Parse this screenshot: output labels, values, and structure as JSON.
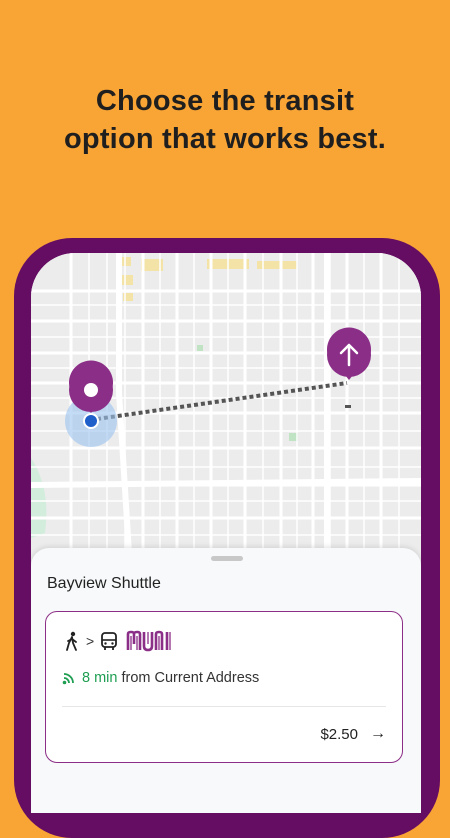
{
  "headline": {
    "line1": "Choose the transit",
    "line2": "option that works best."
  },
  "map": {
    "origin_pin_icon": "location-pin-icon",
    "destination_pin_icon": "up-arrow-pin-icon",
    "accent_color": "#8B2E87"
  },
  "sheet": {
    "title": "Bayview Shuttle"
  },
  "route_card": {
    "legs_separator": ">",
    "walk_icon": "walk-icon",
    "bus_icon": "bus-icon",
    "agency_logo": "muni-logo",
    "eta_minutes": "8 min",
    "eta_suffix": "from Current Address",
    "fare": "$2.50",
    "fare_arrow": "→",
    "live_color": "#1E9E52"
  },
  "colors": {
    "background": "#F9A535",
    "phone_frame": "#650C63",
    "brand_purple": "#8B2E87"
  }
}
